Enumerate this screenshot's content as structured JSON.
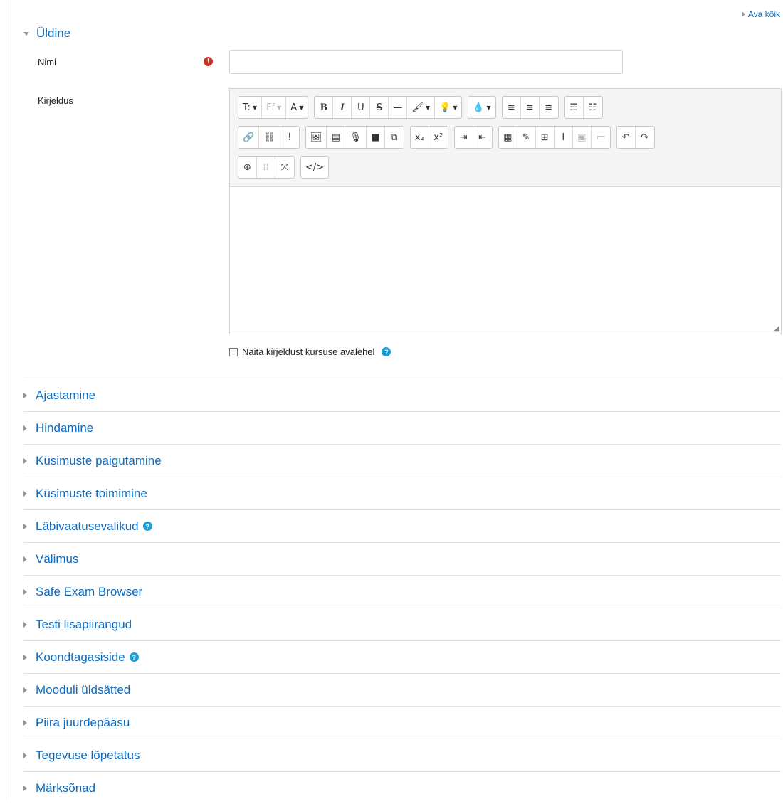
{
  "expand_all_label": "Ava kõik",
  "general": {
    "title": "Üldine",
    "name_label": "Nimi",
    "name_value": "",
    "required_symbol": "!",
    "description_label": "Kirjeldus",
    "show_description_label": "Näita kirjeldust kursuse avalehel"
  },
  "toolbar": {
    "row1": [
      [
        {
          "name": "paragraph-style-button",
          "text": "T:",
          "caret": true
        },
        {
          "name": "font-family-button",
          "text": "Ff",
          "caret": true,
          "dim": true
        },
        {
          "name": "font-size-button",
          "text": "A",
          "caret": true
        }
      ],
      [
        {
          "name": "bold-button",
          "text": "B",
          "serif": true
        },
        {
          "name": "italic-button",
          "text": "I",
          "serif": true,
          "italic": true
        },
        {
          "name": "underline-button",
          "text": "U"
        },
        {
          "name": "strikethrough-button",
          "text": "S̶"
        },
        {
          "name": "horizontal-rule-button",
          "text": "—"
        },
        {
          "name": "font-color-button",
          "text": "🖌",
          "caret": true
        },
        {
          "name": "background-color-button",
          "text": "💡",
          "caret": true
        }
      ],
      [
        {
          "name": "text-color-button",
          "text": "💧",
          "caret": true
        }
      ],
      [
        {
          "name": "align-left-button",
          "text": "≡"
        },
        {
          "name": "align-center-button",
          "text": "≡"
        },
        {
          "name": "align-right-button",
          "text": "≡"
        }
      ],
      [
        {
          "name": "unordered-list-button",
          "text": "☰"
        },
        {
          "name": "ordered-list-button",
          "text": "☷"
        }
      ]
    ],
    "row2": [
      [
        {
          "name": "link-button",
          "text": "🔗"
        },
        {
          "name": "unlink-button",
          "text": "⛓"
        },
        {
          "name": "no-autolink-button",
          "text": "!"
        }
      ],
      [
        {
          "name": "insert-image-button",
          "text": "🖼"
        },
        {
          "name": "insert-media-button",
          "text": "▤"
        },
        {
          "name": "record-audio-button",
          "text": "🎙"
        },
        {
          "name": "record-video-button",
          "text": "■"
        },
        {
          "name": "manage-files-button",
          "text": "⧉"
        }
      ],
      [
        {
          "name": "subscript-button",
          "text": "x₂"
        },
        {
          "name": "superscript-button",
          "text": "x²"
        }
      ],
      [
        {
          "name": "indent-button",
          "text": "⇥"
        },
        {
          "name": "outdent-button",
          "text": "⇤"
        }
      ],
      [
        {
          "name": "equation-button",
          "text": "▦"
        },
        {
          "name": "special-char-button",
          "text": "✎"
        },
        {
          "name": "table-button",
          "text": "⊞"
        },
        {
          "name": "clear-format-button",
          "text": "Ι"
        },
        {
          "name": "screenreader-helper-button",
          "text": "▣",
          "dim": true
        },
        {
          "name": "html-tidy-button",
          "text": "▭",
          "dim": true
        }
      ],
      [
        {
          "name": "undo-button",
          "text": "↶"
        },
        {
          "name": "redo-button",
          "text": "↷"
        }
      ]
    ],
    "row3": [
      [
        {
          "name": "accessibility-checker-button",
          "text": "⊛"
        },
        {
          "name": "wiris-button",
          "text": "⁞⁞",
          "dim": true
        },
        {
          "name": "fullscreen-button",
          "text": "⤧"
        }
      ],
      [
        {
          "name": "html-source-button",
          "text": "</>"
        }
      ]
    ]
  },
  "sections": [
    {
      "label": "Ajastamine",
      "help": false
    },
    {
      "label": "Hindamine",
      "help": false
    },
    {
      "label": "Küsimuste paigutamine",
      "help": false
    },
    {
      "label": "Küsimuste toimimine",
      "help": false
    },
    {
      "label": "Läbivaatusevalikud",
      "help": true
    },
    {
      "label": "Välimus",
      "help": false
    },
    {
      "label": "Safe Exam Browser",
      "help": false
    },
    {
      "label": "Testi lisapiirangud",
      "help": false
    },
    {
      "label": "Koondtagasiside",
      "help": true
    },
    {
      "label": "Mooduli üldsätted",
      "help": false
    },
    {
      "label": "Piira juurdepääsu",
      "help": false
    },
    {
      "label": "Tegevuse lõpetatus",
      "help": false
    },
    {
      "label": "Märksõnad",
      "help": false
    }
  ],
  "icons": {
    "collapsed": "caret-right-icon",
    "expanded": "caret-down-icon",
    "help": "question-circle-icon",
    "required": "exclamation-circle-icon"
  },
  "colors": {
    "link": "#0f6cbf",
    "required": "#ca3120",
    "help": "#1a9fd9"
  }
}
